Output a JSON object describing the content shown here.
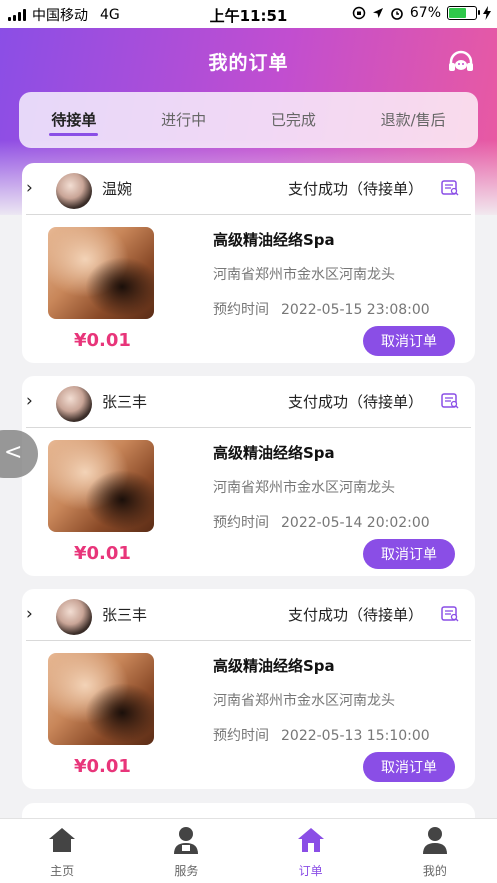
{
  "status_bar": {
    "carrier": "中国移动",
    "network": "4G",
    "time": "上午11:51",
    "battery": "67%",
    "battery_fraction": 0.67
  },
  "header": {
    "title": "我的订单",
    "support_icon": "headset-icon"
  },
  "tabs": [
    {
      "label": "待接单",
      "active": true
    },
    {
      "label": "进行中",
      "active": false
    },
    {
      "label": "已完成",
      "active": false
    },
    {
      "label": "退款/售后",
      "active": false
    }
  ],
  "orders": [
    {
      "user": "温婉",
      "status": "支付成功（待接单）",
      "title": "高级精油经络Spa",
      "address": "河南省郑州市金水区河南龙头",
      "time_label": "预约时间",
      "time": "2022-05-15 23:08:00",
      "price": "¥0.01",
      "button": "取消订单"
    },
    {
      "user": "张三丰",
      "status": "支付成功（待接单）",
      "title": "高级精油经络Spa",
      "address": "河南省郑州市金水区河南龙头",
      "time_label": "预约时间",
      "time": "2022-05-14 20:02:00",
      "price": "¥0.01",
      "button": "取消订单"
    },
    {
      "user": "张三丰",
      "status": "支付成功（待接单）",
      "title": "高级精油经络Spa",
      "address": "河南省郑州市金水区河南龙头",
      "time_label": "预约时间",
      "time": "2022-05-13 15:10:00",
      "price": "¥0.01",
      "button": "取消订单"
    }
  ],
  "tabbar": [
    {
      "label": "主页",
      "icon": "home-icon",
      "active": false
    },
    {
      "label": "服务",
      "icon": "service-icon",
      "active": false
    },
    {
      "label": "订单",
      "icon": "order-icon",
      "active": true
    },
    {
      "label": "我的",
      "icon": "profile-icon",
      "active": false
    }
  ],
  "colors": {
    "accent": "#8a4ee6",
    "price": "#e8357a",
    "gradient_start": "#8a4ee6",
    "gradient_end": "#ea5aa0"
  }
}
